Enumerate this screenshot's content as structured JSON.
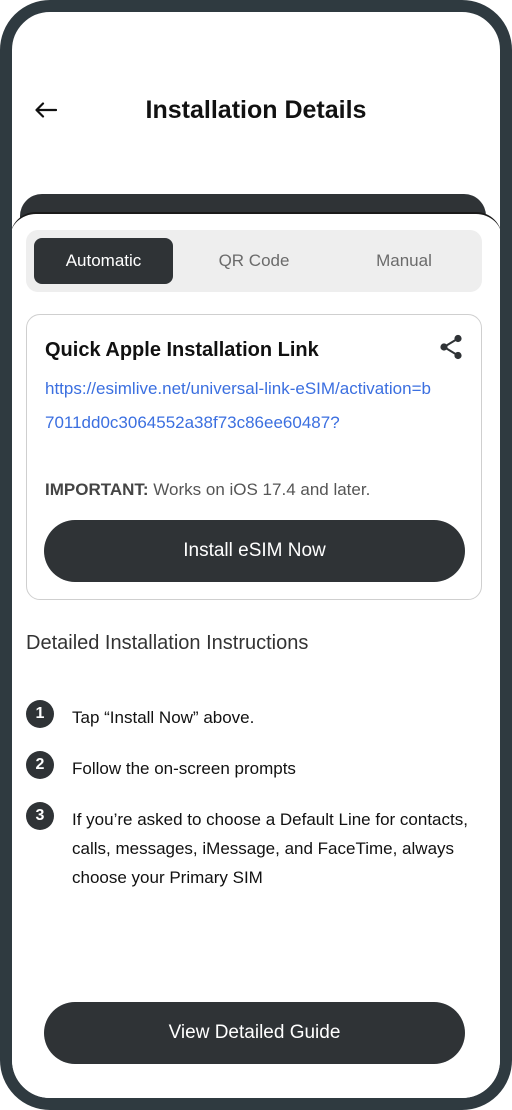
{
  "header": {
    "title": "Installation Details",
    "back_icon": "arrow-left-icon"
  },
  "tabs": [
    {
      "label": "Automatic",
      "active": true
    },
    {
      "label": "QR Code",
      "active": false
    },
    {
      "label": "Manual",
      "active": false
    }
  ],
  "card": {
    "title": "Quick Apple Installation Link",
    "share_icon": "share-icon",
    "link": "https://esimlive.net/universal-link-eSIM/activation=b7011dd0c3064552a38f73c86ee60487?",
    "important_label": "IMPORTANT:",
    "important_text": " Works on iOS 17.4 and later.",
    "install_button": "Install eSIM Now"
  },
  "instructions": {
    "title": "Detailed Installation Instructions",
    "steps": [
      {
        "number": "1",
        "text": "Tap “Install Now” above."
      },
      {
        "number": "2",
        "text": "Follow the on-screen prompts"
      },
      {
        "number": "3",
        "text": "If you’re asked to choose a Default Line for contacts, calls, messages, iMessage, and FaceTime, always choose your Primary SIM"
      }
    ]
  },
  "footer": {
    "guide_button": "View Detailed Guide"
  },
  "colors": {
    "frame": "#2f3a40",
    "dark": "#2f3336",
    "link": "#3b6fe0",
    "tabs_bg": "#eeeeee"
  }
}
